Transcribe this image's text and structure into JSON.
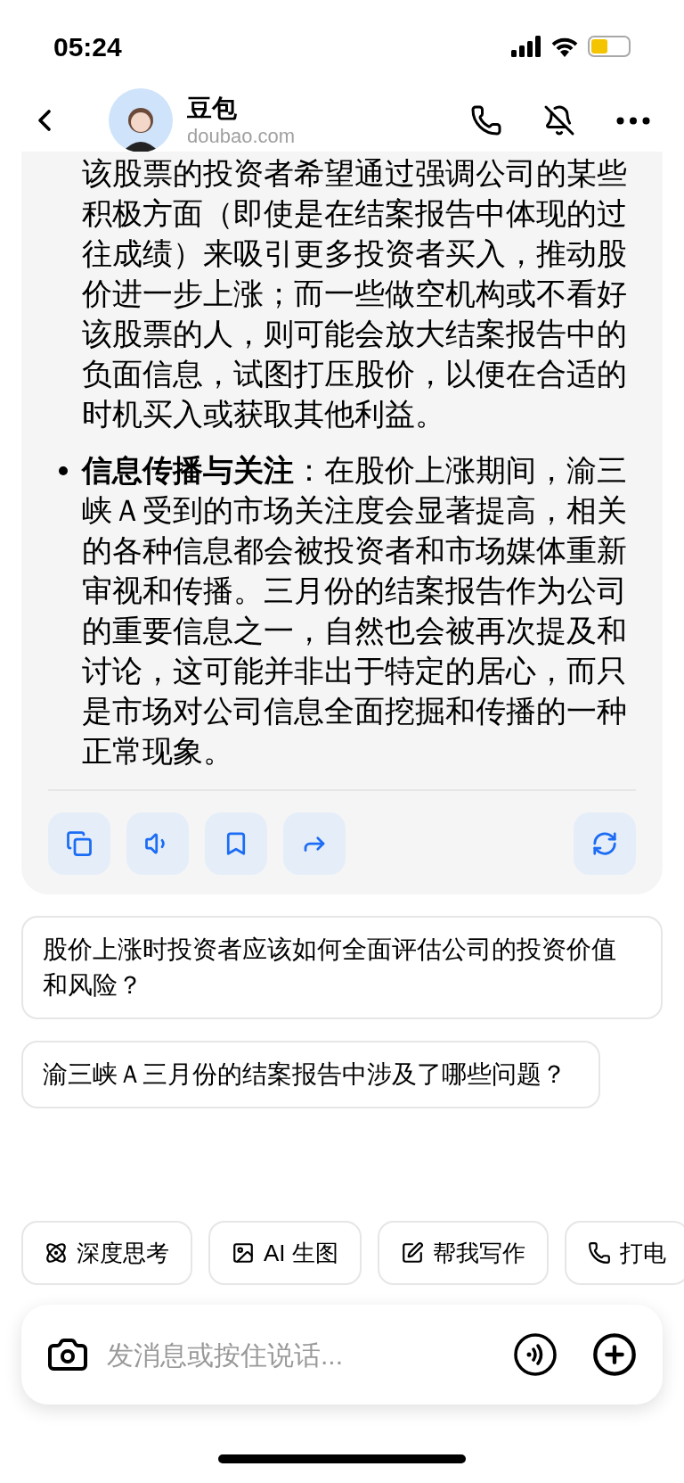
{
  "status_bar": {
    "time": "05:24"
  },
  "header": {
    "title": "豆包",
    "subtitle": "doubao.com"
  },
  "message": {
    "paragraphs": [
      {
        "kind": "text",
        "text": "该股票的投资者希望通过强调公司的某些积极方面（即使是在结案报告中体现的过往成绩）来吸引更多投资者买入，推动股价进一步上涨；而一些做空机构或不看好该股票的人，则可能会放大结案报告中的负面信息，试图打压股价，以便在合适的时机买入或获取其他利益。"
      },
      {
        "kind": "bullet",
        "text": "**信息传播与关注**：在股价上涨期间，渝三峡Ａ受到的市场关注度会显著提高，相关的各种信息都会被投资者和市场媒体重新审视和传播。三月份的结案报告作为公司的重要信息之一，自然也会被再次提及和讨论，这可能并非出于特定的居心，而只是市场对公司信息全面挖掘和传播的一种正常现象。"
      }
    ],
    "actions": [
      {
        "kind": "copy"
      },
      {
        "kind": "speak"
      },
      {
        "kind": "bookmark"
      },
      {
        "kind": "share"
      },
      {
        "kind": "regenerate"
      }
    ]
  },
  "suggestions": [
    "股价上涨时投资者应该如何全面评估公司的投资价值和风险？",
    "渝三峡Ａ三月份的结案报告中涉及了哪些问题？"
  ],
  "chips": [
    {
      "kind": "think",
      "label": "深度思考"
    },
    {
      "kind": "image",
      "label": "AI 生图"
    },
    {
      "kind": "write",
      "label": "帮我写作"
    },
    {
      "kind": "call",
      "label": "打电"
    }
  ],
  "input": {
    "placeholder": "发消息或按住说话..."
  }
}
